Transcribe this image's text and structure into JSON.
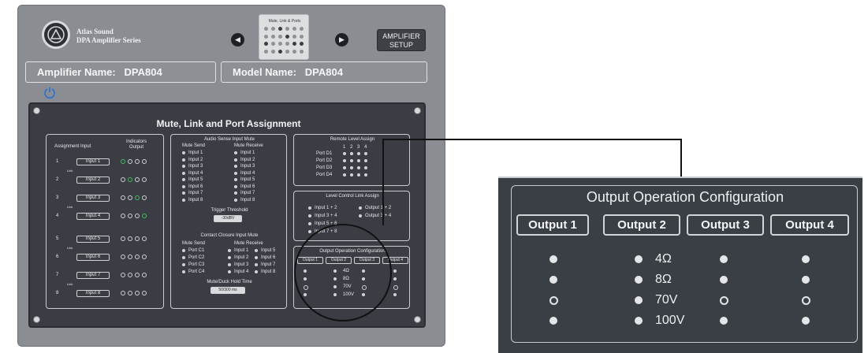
{
  "brand": {
    "line1": "Atlas Sound",
    "line2": "DPA Amplifier Series"
  },
  "thumbnail": {
    "title": "Mute, Link & Ports"
  },
  "setup_button": {
    "line1": "AMPLIFIER",
    "line2": "SETUP"
  },
  "amplifier_name": {
    "label": "Amplifier Name:",
    "value": "DPA804"
  },
  "model_name": {
    "label": "Model Name:",
    "value": "DPA804"
  },
  "panel": {
    "title": "Mute, Link and Port Assignment",
    "assignment": {
      "header_left": "Assignment Input",
      "header_right": "Indicators Output",
      "rows": [
        {
          "num": "1",
          "input": "Input 1",
          "green": 0
        },
        {
          "num": "2",
          "input": "Input 2",
          "green": 1
        },
        {
          "num": "3",
          "input": "Input 3",
          "green": 2
        },
        {
          "num": "4",
          "input": "Input 4",
          "green": 3
        },
        {
          "num": "5",
          "input": "Input 5",
          "green": -1
        },
        {
          "num": "6",
          "input": "Input 6",
          "green": -1
        },
        {
          "num": "7",
          "input": "Input 7",
          "green": -1
        },
        {
          "num": "8",
          "input": "Input 8",
          "green": -1
        }
      ],
      "link_label": "Link"
    },
    "audio_sense": {
      "title": "Audio Sense Input Mute",
      "col1": "Mute Send",
      "col2": "Mute Receive",
      "inputs": [
        "Input 1",
        "Input 2",
        "Input 3",
        "Input 4",
        "Input 5",
        "Input 6",
        "Input 7",
        "Input 8"
      ],
      "trigger_label": "Trigger Threshold",
      "trigger_value": "-30dBV"
    },
    "contact_closure": {
      "title": "Contact Closure Input Mute",
      "col1": "Mute Send",
      "col2": "Mute Receive",
      "ports": [
        "Port C1",
        "Port C2",
        "Port C3",
        "Port C4"
      ],
      "recv_a": [
        "Input 1",
        "Input 2",
        "Input 3",
        "Input 4"
      ],
      "recv_b": [
        "Input 5",
        "Input 6",
        "Input 7",
        "Input 8"
      ],
      "hold_label": "Mute/Duck Hold Time",
      "hold_value": "50/300 ms"
    },
    "remote_level": {
      "title": "Remote Level Assign",
      "cols": [
        "1",
        "2",
        "3",
        "4"
      ],
      "ports": [
        "Port D1",
        "Port D2",
        "Port D3",
        "Port D4"
      ]
    },
    "level_link": {
      "title": "Level Control Link Assign",
      "items": [
        "Input 1 + 2",
        "Output 1 + 2",
        "Input 3 + 4",
        "Output 3 + 4",
        "Input 5 + 6",
        "Input 7 + 8"
      ]
    },
    "output_config_small": {
      "title": "Output Operation Configuration",
      "outputs": [
        "Output 1",
        "Output 2",
        "Output 3",
        "Output 4"
      ],
      "levels": [
        "4Ω",
        "8Ω",
        "70V",
        "100V"
      ]
    }
  },
  "zoom": {
    "title": "Output Operation Configuration",
    "outputs": [
      "Output 1",
      "Output 2",
      "Output 3",
      "Output 4"
    ],
    "levels": [
      "4Ω",
      "8Ω",
      "70V",
      "100V"
    ]
  }
}
